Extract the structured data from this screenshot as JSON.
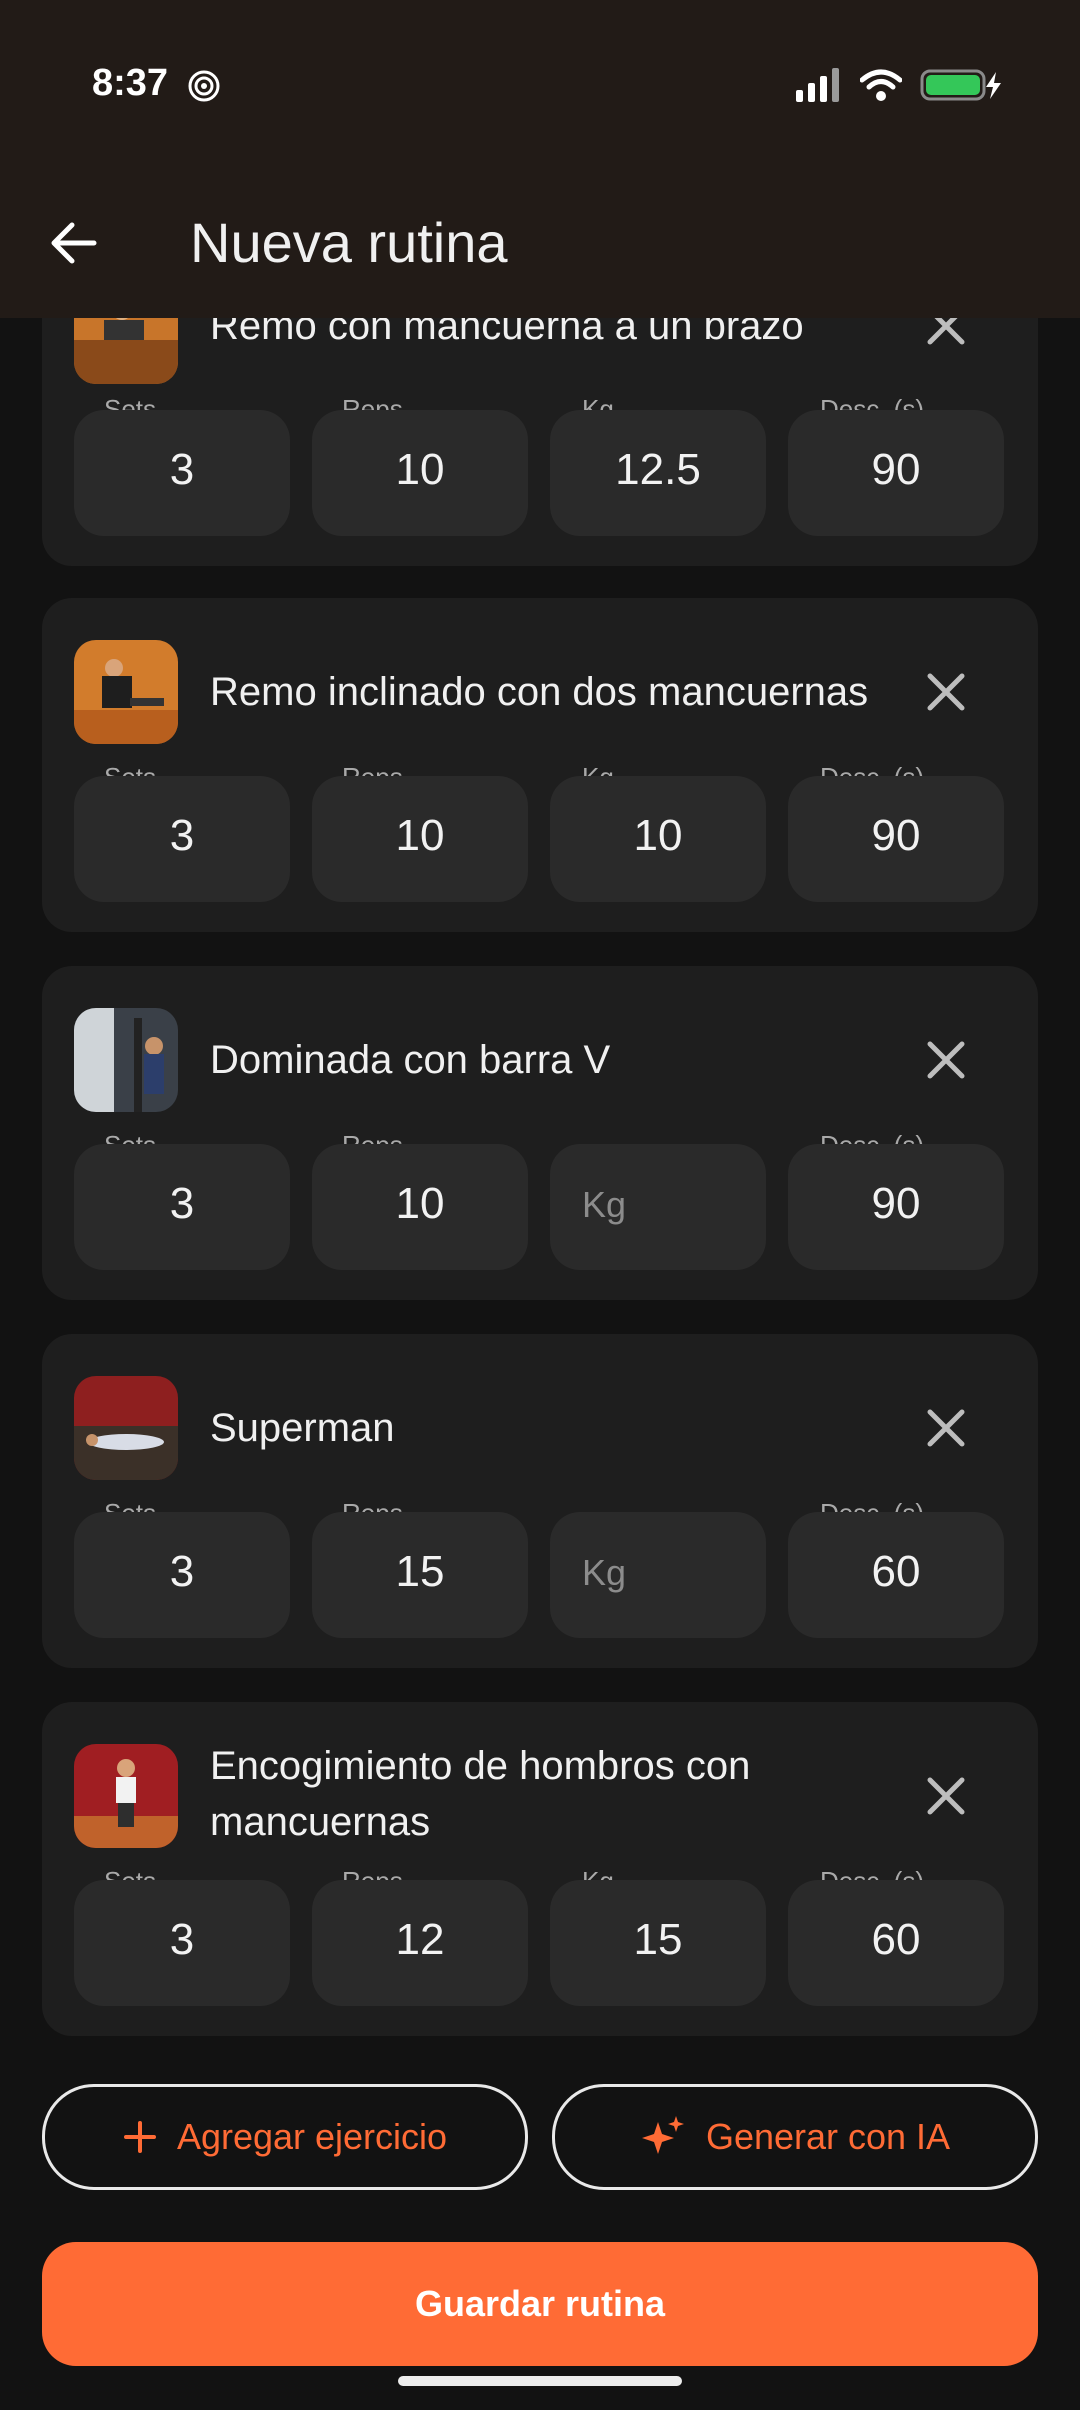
{
  "status_bar": {
    "time": "8:37",
    "battery_color": "#34C759"
  },
  "header": {
    "title": "Nueva rutina",
    "back_icon": "arrow-left-icon"
  },
  "field_labels": {
    "sets": "Sets",
    "reps": "Reps",
    "kg": "Kg",
    "rest": "Desc. (s)"
  },
  "exercises": [
    {
      "name": "Remo con mancuerna a un brazo",
      "sets": "3",
      "reps": "10",
      "kg": "12.5",
      "rest": "90"
    },
    {
      "name": "Remo inclinado con dos mancuernas",
      "sets": "3",
      "reps": "10",
      "kg": "10",
      "rest": "90"
    },
    {
      "name": "Dominada con barra V",
      "sets": "3",
      "reps": "10",
      "kg": "",
      "kg_placeholder": "Kg",
      "rest": "90"
    },
    {
      "name": "Superman",
      "sets": "3",
      "reps": "15",
      "kg": "",
      "kg_placeholder": "Kg",
      "rest": "60"
    },
    {
      "name": "Encogimiento de hombros con mancuernas",
      "name_line1": "Encogimiento de hombros con",
      "name_line2": "mancuernas",
      "sets": "3",
      "reps": "12",
      "kg": "15",
      "rest": "60"
    }
  ],
  "actions": {
    "add_exercise": "Agregar ejercicio",
    "generate_ai": "Generar con IA",
    "save": "Guardar rutina"
  },
  "colors": {
    "accent": "#FF6B35",
    "card": "#1E1E1E",
    "field": "#2A2A2A",
    "background": "#121212",
    "appbar": "#221B17"
  }
}
